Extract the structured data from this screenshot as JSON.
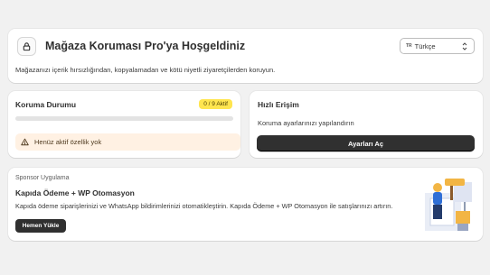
{
  "header": {
    "title": "Mağaza Koruması Pro'ya Hoşgeldiniz",
    "description": "Mağazanızı içerik hırsızlığından, kopyalamadan ve kötü niyetli ziyaretçilerden koruyun.",
    "language": {
      "flag": "TR",
      "selected": "Türkçe"
    }
  },
  "protection": {
    "title": "Koruma Durumu",
    "badge": "0 / 9 Aktif",
    "progress_fraction": 0,
    "warning": "Henüz aktif özellik yok"
  },
  "quick_access": {
    "title": "Hızlı Erişim",
    "description": "Koruma ayarlarınızı yapılandırın",
    "button": "Ayarları Aç"
  },
  "sponsor": {
    "label": "Sponsor Uygulama",
    "title": "Kapıda Ödeme + WP Otomasyon",
    "description": "Kapıda ödeme siparişlerinizi ve WhatsApp bildirimlerinizi otomatikleştirin. Kapıda Ödeme + WP Otomasyon ile satışlarınızı artırın.",
    "button": "Hemen Yükle"
  },
  "icons": {
    "lock": "lock-icon",
    "chevron": "chevron-updown-icon",
    "warning": "warning-icon",
    "illustration": "painter-illustration"
  },
  "colors": {
    "background": "#f1f1f1",
    "primary_button": "#303030",
    "badge": "#ffe54f",
    "warning_bg": "#fff1e3"
  }
}
